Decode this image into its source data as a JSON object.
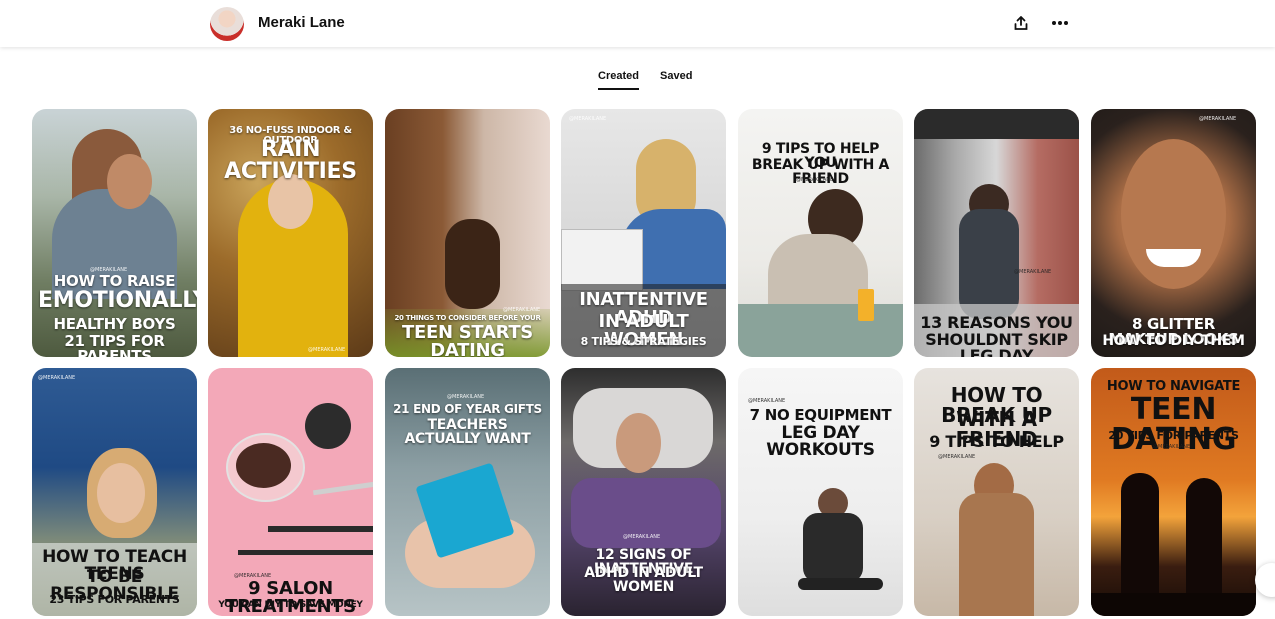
{
  "header": {
    "profile_name": "Meraki Lane",
    "share_icon": "share-icon",
    "more_icon": "more-icon"
  },
  "tabs": [
    {
      "label": "Created",
      "active": true
    },
    {
      "label": "Saved",
      "active": false
    }
  ],
  "pins": [
    {
      "title": "HOW TO RAISE EMOTIONALLY HEALTHY BOYS 21 TIPS FOR PARENTS",
      "lines": [
        "HOW TO RAISE",
        "EMOTIONALLY",
        "HEALTHY BOYS",
        "21 TIPS FOR PARENTS"
      ],
      "watermark": "@MERAKILANE"
    },
    {
      "title": "36 NO-FUSS INDOOR & OUTDOOR RAIN ACTIVITIES",
      "lines": [
        "36 NO-FUSS INDOOR & OUTDOOR",
        "RAIN ACTIVITIES"
      ],
      "watermark": "@MERAKILANE"
    },
    {
      "title": "20 THINGS TO CONSIDER BEFORE YOUR TEEN STARTS DATING",
      "lines": [
        "20 THINGS TO CONSIDER BEFORE YOUR",
        "TEEN STARTS DATING"
      ],
      "watermark": "@MERAKILANE"
    },
    {
      "title": "INATTENTIVE ADHD IN ADULT WOMEN 8 TIPS & STRATEGIES",
      "lines": [
        "INATTENTIVE ADHD",
        "IN ADULT WOMEN",
        "8 TIPS & STRATEGIES"
      ],
      "watermark": "@MERAKILANE"
    },
    {
      "title": "9 TIPS TO HELP YOU BREAK UP WITH A FRIEND",
      "lines": [
        "9 TIPS TO HELP YOU",
        "BREAK UP WITH A FRIEND"
      ],
      "watermark": "@MERAKILANE"
    },
    {
      "title": "13 REASONS YOU SHOULDNT SKIP LEG DAY",
      "lines": [
        "13 REASONS YOU",
        "SHOULDNT SKIP LEG DAY"
      ],
      "watermark": "@MERAKILANE"
    },
    {
      "title": "8 GLITTER MAKEUP LOOKS HOW TO DIY THEM",
      "lines": [
        "8 GLITTER MAKEUP LOOKS",
        "HOW TO DIY THEM"
      ],
      "watermark": "@MERAKILANE"
    },
    {
      "title": "HOW TO TEACH TEENS TO BE RESPONSIBLE 23 TIPS FOR PARENTS",
      "lines": [
        "HOW TO TEACH TEENS",
        "TO BE RESPONSIBLE",
        "23 TIPS FOR PARENTS"
      ],
      "watermark": "@MERAKILANE"
    },
    {
      "title": "9 SALON TREATMENTS YOU CAN DIY TO SAVE MONEY",
      "lines": [
        "9 SALON TREATMENTS",
        "YOU CAN DIY TO SAVE MONEY"
      ],
      "watermark": "@MERAKILANE"
    },
    {
      "title": "21 END OF YEAR GIFTS TEACHERS ACTUALLY WANT",
      "lines": [
        "21 END OF YEAR GIFTS",
        "TEACHERS ACTUALLY WANT"
      ],
      "watermark": "@MERAKILANE"
    },
    {
      "title": "12 SIGNS OF INATTENTIVE ADHD IN ADULT WOMEN",
      "lines": [
        "12 SIGNS OF INATTENTIVE",
        "ADHD IN ADULT WOMEN"
      ],
      "watermark": "@MERAKILANE"
    },
    {
      "title": "7 NO EQUIPMENT LEG DAY WORKOUTS",
      "lines": [
        "7 NO EQUIPMENT",
        "LEG DAY WORKOUTS"
      ],
      "watermark": "@MERAKILANE"
    },
    {
      "title": "HOW TO BREAK UP WITH A FRIEND 9 TIPS TO HELP",
      "lines": [
        "HOW TO BREAK UP",
        "WITH A FRIEND",
        "9 TIPS TO HELP"
      ],
      "watermark": "@MERAKILANE"
    },
    {
      "title": "HOW TO NAVIGATE TEEN DATING 20 TIPS FOR PARENTS",
      "lines": [
        "HOW TO NAVIGATE",
        "TEEN DATING",
        "20 TIPS FOR PARENTS"
      ],
      "watermark": "@MERAKILANE"
    }
  ]
}
